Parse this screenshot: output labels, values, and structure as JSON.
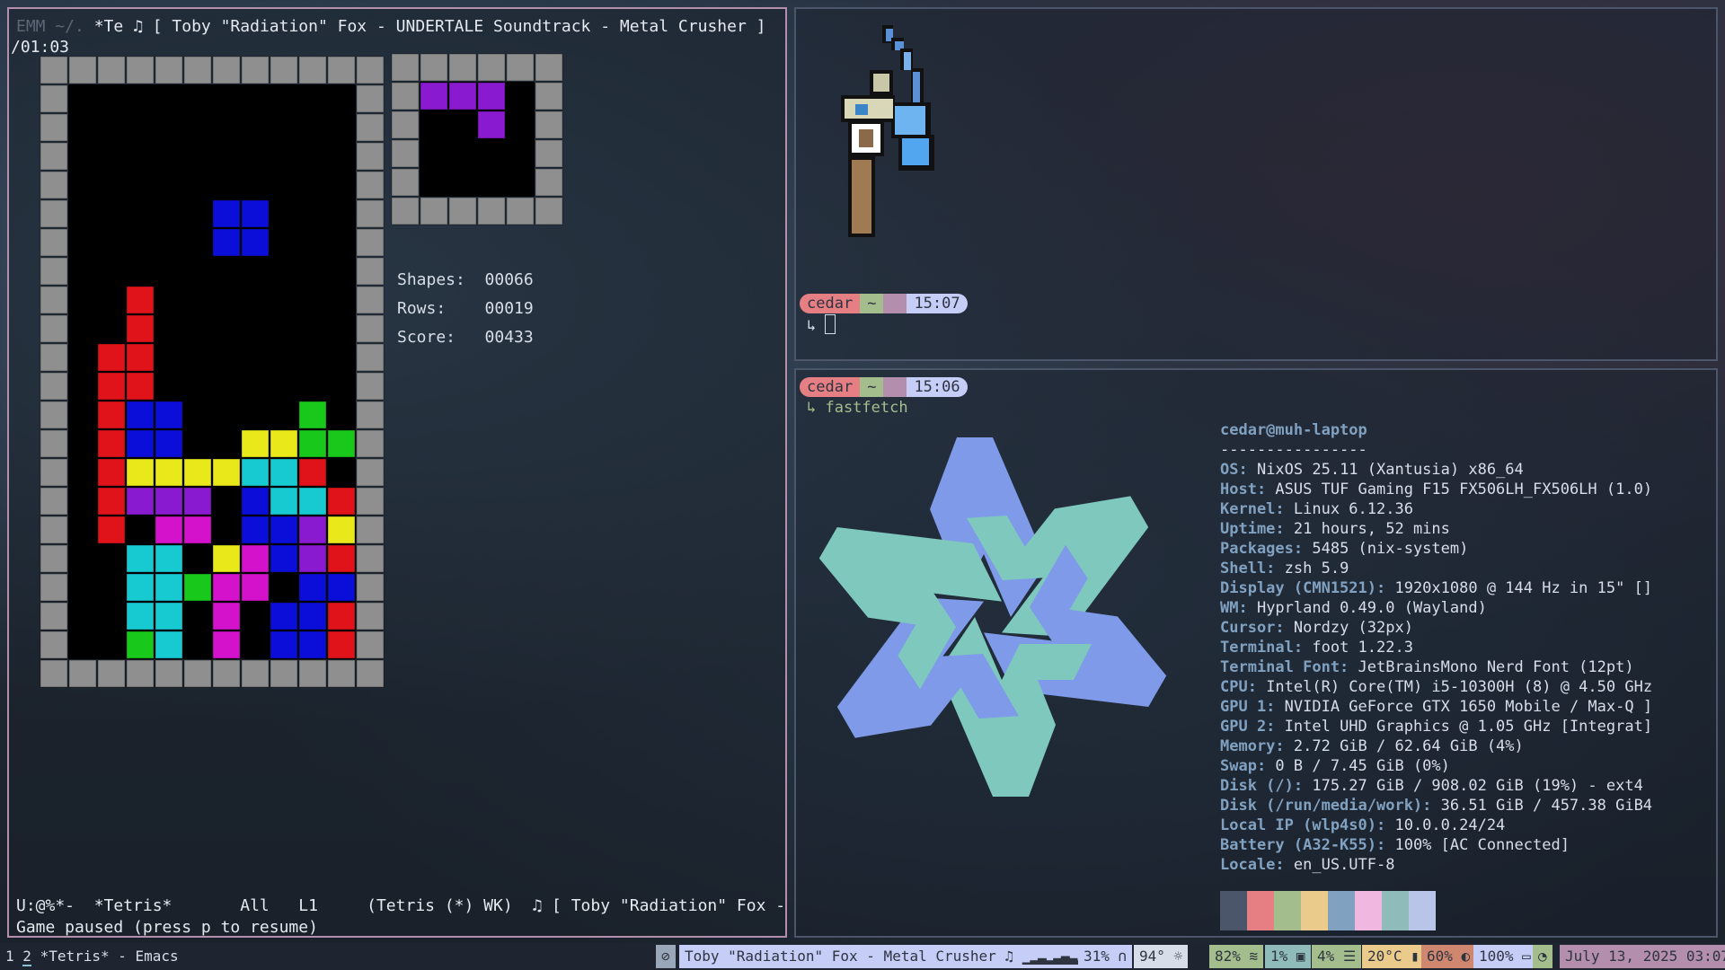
{
  "emacs": {
    "header_dim": "EMM ~/. ",
    "header_marker": "*Te",
    "header_music": "♫ [ Toby \"Radiation\" Fox - UNDERTALE Soundtrack - Metal Crusher ]  00:16",
    "header_cont": "/01:03",
    "stats": {
      "shapes_label": "Shapes:",
      "shapes": "00066",
      "rows_label": "Rows:",
      "rows": "00019",
      "score_label": "Score:",
      "score": "00433"
    },
    "modeline": "U:@%*-  *Tetris*       All   L1     (Tetris (*) WK)  ♫ [ Toby \"Radiation\" Fox - UNDER",
    "echo": "Game paused (press p to resume)"
  },
  "tetris": {
    "colors": {
      "R": "#e0131b",
      "B": "#0a0ed8",
      "Y": "#e8e81a",
      "C": "#17c9d0",
      "G": "#18c81a",
      "M": "#d412cc",
      "P": "#8a1ad0"
    },
    "board": [
      "..........",
      "..........",
      "..........",
      "..........",
      ".....BB...",
      ".....BB...",
      "..........",
      "..R.......",
      "..R.......",
      ".RR.......",
      ".RR.......",
      ".RBB....G.",
      ".RBB..YYGG",
      ".RYYYYCCR.",
      ".RPPP.BCCR",
      ".R.MM.BBPY",
      "..CC.YMBPR",
      "..CCGMM.BBR",
      "..CC.M.BBR",
      "..GC.M.BBR",
      "..GGGMM.YYYR"
    ],
    "next": [
      "PPP",
      "..P"
    ]
  },
  "term1": {
    "prompt": {
      "user": "cedar",
      "dir": "~",
      "time": "15:07"
    },
    "cmd_prefix": "↳ "
  },
  "term2": {
    "prompt": {
      "user": "cedar",
      "dir": "~",
      "time": "15:06"
    },
    "cmd": "↳ fastfetch",
    "title": "cedar@muh-laptop",
    "sep": "----------------",
    "info": [
      {
        "k": "OS",
        "v": "NixOS 25.11 (Xantusia) x86_64"
      },
      {
        "k": "Host",
        "v": "ASUS TUF Gaming F15 FX506LH_FX506LH (1.0)"
      },
      {
        "k": "Kernel",
        "v": "Linux 6.12.36"
      },
      {
        "k": "Uptime",
        "v": "21 hours, 52 mins"
      },
      {
        "k": "Packages",
        "v": "5485 (nix-system)"
      },
      {
        "k": "Shell",
        "v": "zsh 5.9"
      },
      {
        "k": "Display (CMN1521)",
        "v": "1920x1080 @ 144 Hz in 15\" []"
      },
      {
        "k": "WM",
        "v": "Hyprland 0.49.0 (Wayland)"
      },
      {
        "k": "Cursor",
        "v": "Nordzy (32px)"
      },
      {
        "k": "Terminal",
        "v": "foot 1.22.3"
      },
      {
        "k": "Terminal Font",
        "v": "JetBrainsMono Nerd Font (12pt)"
      },
      {
        "k": "CPU",
        "v": "Intel(R) Core(TM) i5-10300H (8) @ 4.50 GHz"
      },
      {
        "k": "GPU 1",
        "v": "NVIDIA GeForce GTX 1650 Mobile / Max-Q ]"
      },
      {
        "k": "GPU 2",
        "v": "Intel UHD Graphics @ 1.05 GHz [Integrat]"
      },
      {
        "k": "Memory",
        "v": "2.72 GiB / 62.64 GiB (4%)"
      },
      {
        "k": "Swap",
        "v": "0 B / 7.45 GiB (0%)"
      },
      {
        "k": "Disk (/)",
        "v": "175.27 GiB / 908.02 GiB (19%) - ext4"
      },
      {
        "k": "Disk (/run/media/work)",
        "v": "36.51 GiB / 457.38 GiB4"
      },
      {
        "k": "Local IP (wlp4s0)",
        "v": "10.0.0.24/24"
      },
      {
        "k": "Battery (A32-K55)",
        "v": "100% [AC Connected]"
      },
      {
        "k": "Locale",
        "v": "en_US.UTF-8"
      }
    ],
    "palette": [
      "#4c566a",
      "#e57f84",
      "#a3be8c",
      "#ebcb8b",
      "#81a1c1",
      "#f0b8e0",
      "#8fbcbb",
      "#b8c4e8"
    ]
  },
  "bar": {
    "workspaces": [
      "1",
      "2"
    ],
    "window_title": "*Tetris* - Emacs",
    "music": "Toby \"Radiation\" Fox - Metal Crusher ♫",
    "volume": "31%",
    "temp_out": "94°",
    "wifi": "82%",
    "cpu": "1%",
    "mem": "4%",
    "temp": "20°C",
    "bright": "60%",
    "battery": "100%",
    "datetime": "July 13, 2025 03:07PM"
  }
}
